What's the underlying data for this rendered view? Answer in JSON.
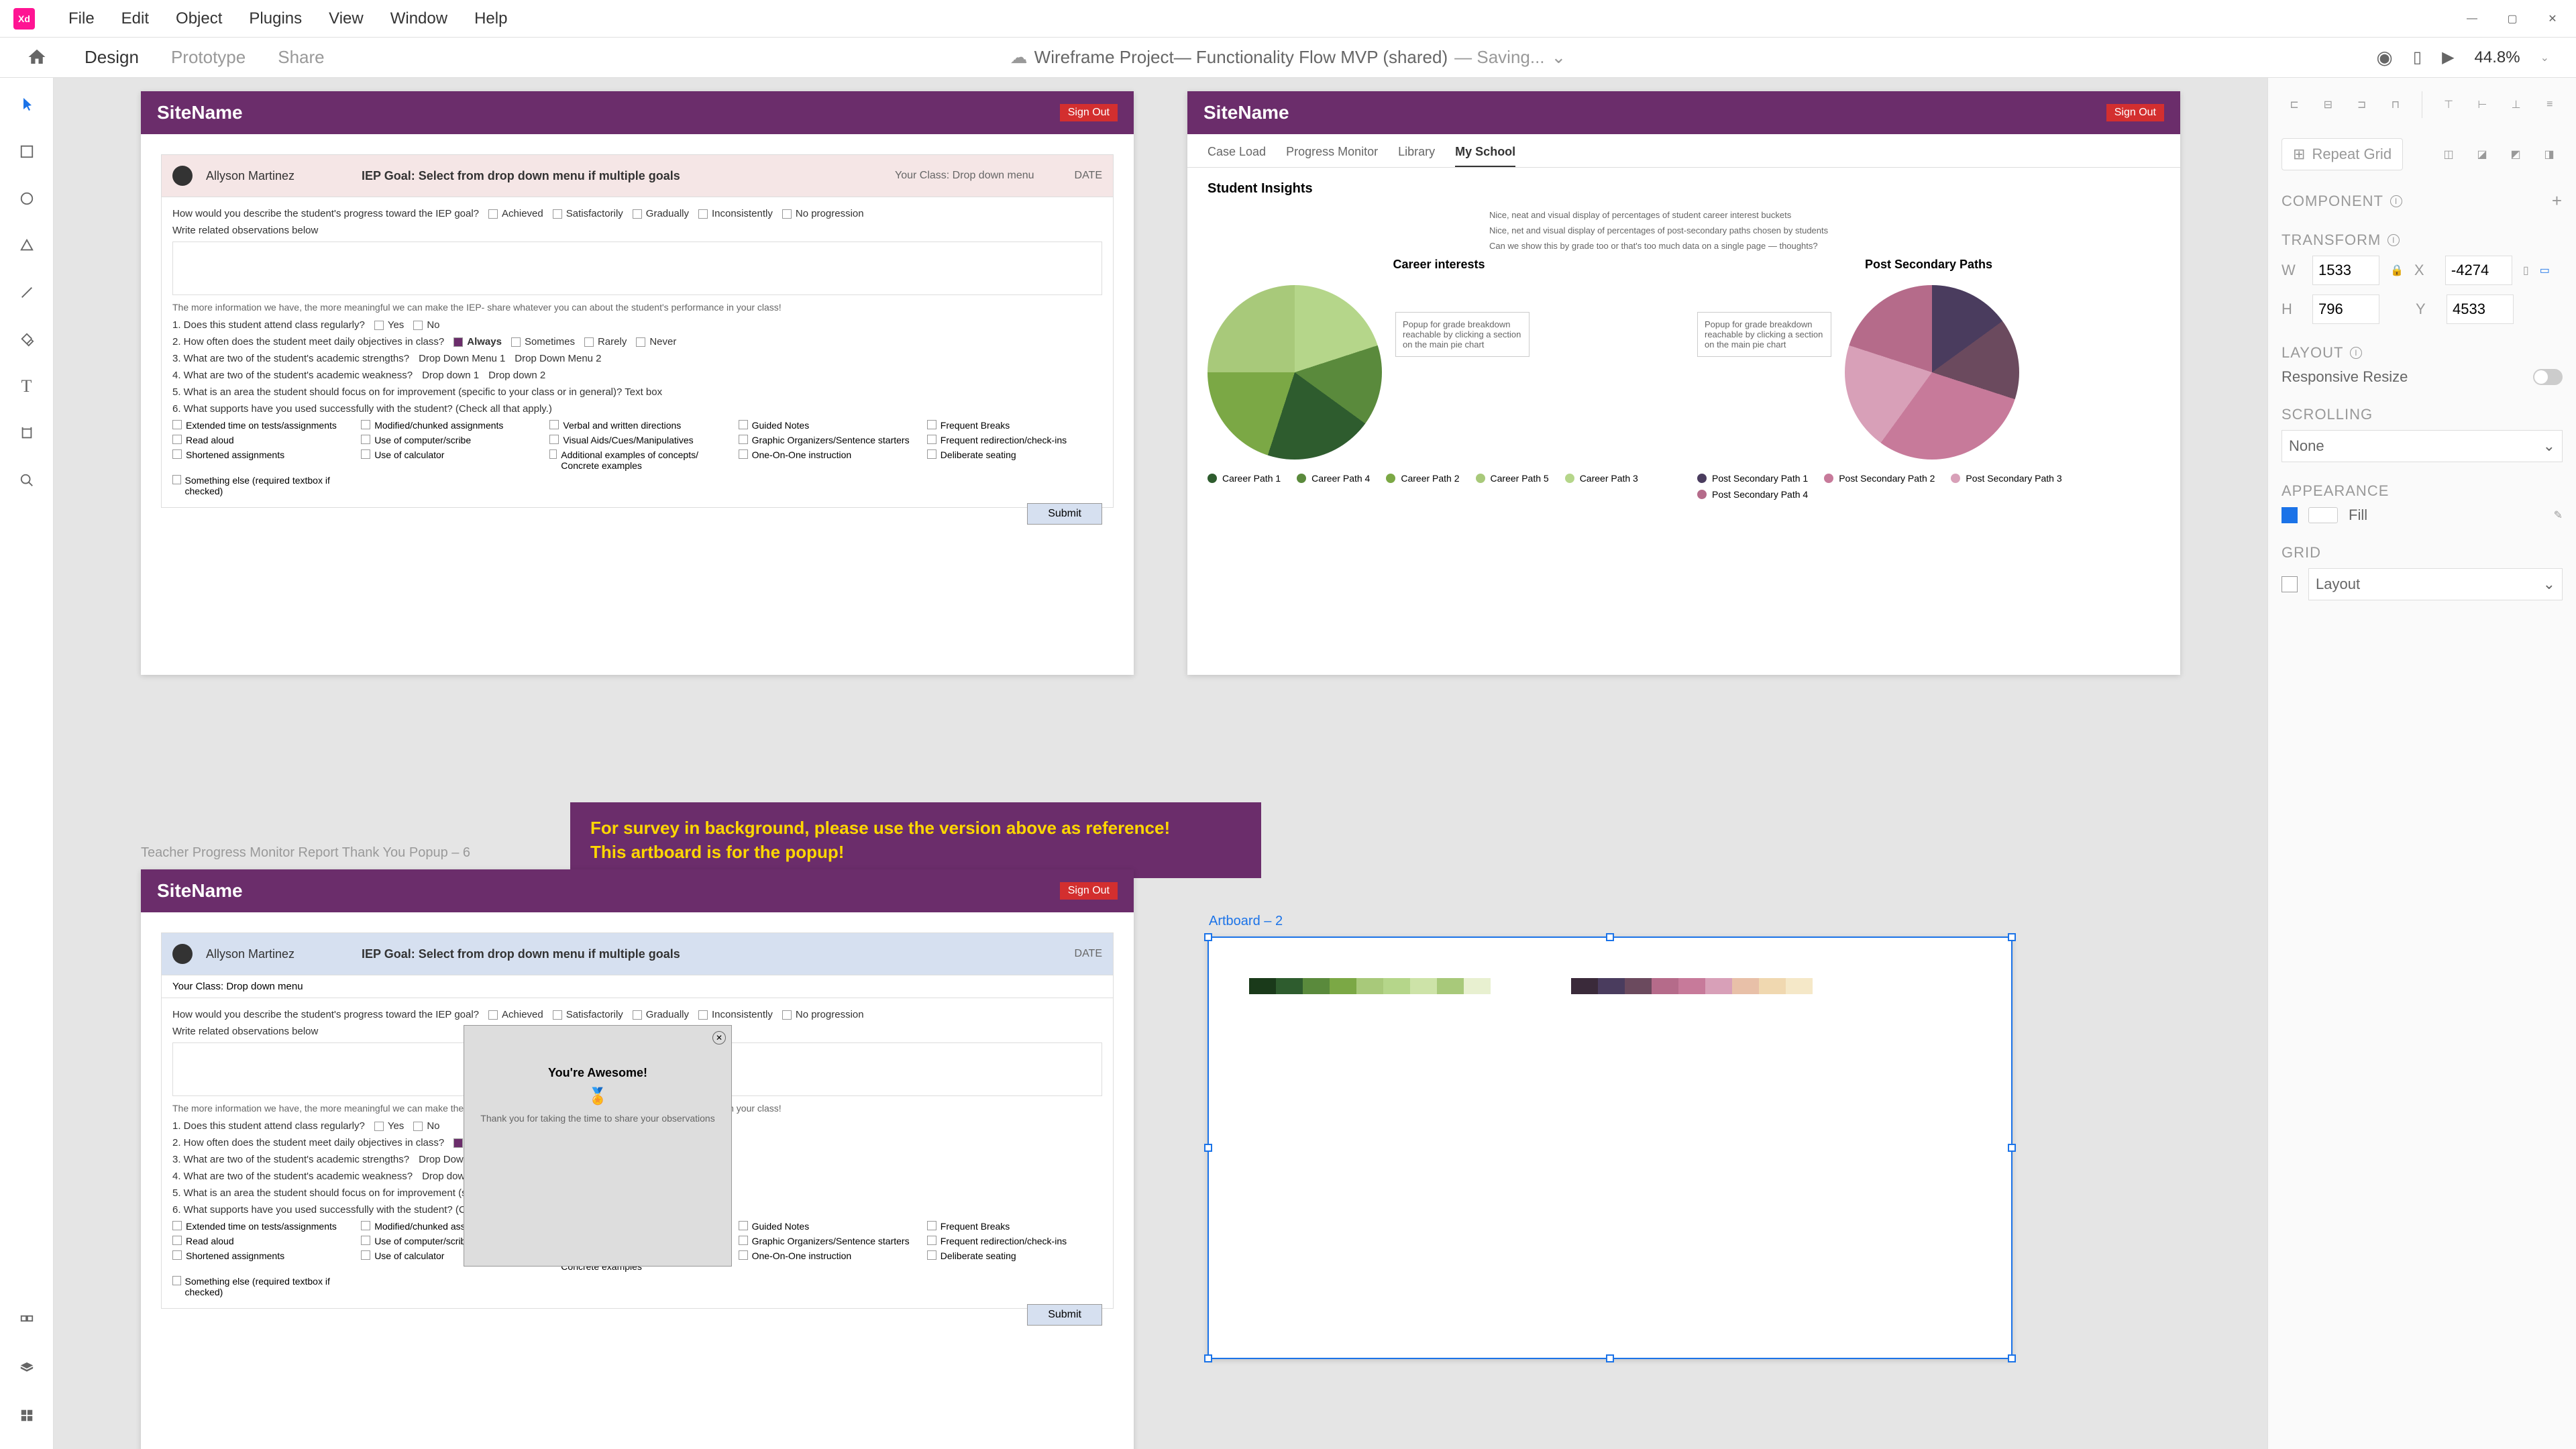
{
  "menu": {
    "items": [
      "File",
      "Edit",
      "Object",
      "Plugins",
      "View",
      "Window",
      "Help"
    ]
  },
  "tabs": {
    "design": "Design",
    "prototype": "Prototype",
    "share": "Share"
  },
  "doc": {
    "title": "Wireframe Project— Functionality Flow MVP (shared)",
    "status": "— Saving..."
  },
  "zoom": "44.8%",
  "rightPanel": {
    "repeatGrid": "Repeat Grid",
    "component": "COMPONENT",
    "transform": "TRANSFORM",
    "w": "1533",
    "x": "-4274",
    "h": "796",
    "y": "4533",
    "layout": "LAYOUT",
    "responsive": "Responsive Resize",
    "scrolling": "SCROLLING",
    "scrollValue": "None",
    "appearance": "APPEARANCE",
    "fill": "Fill",
    "grid": "GRID",
    "gridValue": "Layout"
  },
  "artboardLabels": {
    "ab3": "Teacher Progress Monitor Report Thank You Popup – 6",
    "ab4": "Artboard – 2"
  },
  "site": {
    "name": "SiteName",
    "signOut": "Sign Out"
  },
  "form": {
    "teacher": "Allyson Martinez",
    "iep": "IEP Goal:  Select from drop down menu if multiple goals",
    "yourClass": "Your Class:",
    "dropdown": "Drop down menu",
    "date": "DATE",
    "q1": "How would you describe the student's progress toward the IEP goal?",
    "q1opts": [
      "Achieved",
      "Satisfactorily",
      "Gradually",
      "Inconsistently",
      "No progression"
    ],
    "obs": "Write related observations below",
    "info": "The more information we have, the more meaningful we can make the IEP- share whatever you can about the student's performance in your class!",
    "questions": [
      "1.  Does this student attend class regularly?",
      "2.  How often does the student meet daily objectives in class?",
      "3.  What are two of the student's academic strengths?",
      "4.  What are two of the student's academic weakness?",
      "5.  What is an area the student should focus on for improvement (specific to your class or in general)? Text box",
      "6.  What supports have you used successfully with the student? (Check all that apply.)"
    ],
    "q2a": [
      "Yes",
      "No"
    ],
    "q2b": [
      "Always",
      "Sometimes",
      "Rarely",
      "Never"
    ],
    "q3opts": [
      "Drop Down Menu 1",
      "Drop Down Menu 2"
    ],
    "q4opts": [
      "Drop down 1",
      "Drop down 2"
    ],
    "supports": [
      "Extended time on tests/assignments",
      "Modified/chunked assignments",
      "Verbal and written directions",
      "Guided Notes",
      "Frequent Breaks",
      "Read aloud",
      "Use of computer/scribe",
      "Visual Aids/Cues/Manipulatives",
      "Graphic Organizers/Sentence starters",
      "Frequent redirection/check-ins",
      "Shortened assignments",
      "Use of calculator",
      "Additional examples of concepts/ Concrete examples",
      "One-On-One instruction",
      "Deliberate seating",
      "Something else   (required textbox if checked)"
    ],
    "submit": "Submit"
  },
  "insights": {
    "tabs": [
      "Case Load",
      "Progress Monitor",
      "Library",
      "My School"
    ],
    "title": "Student Insights",
    "chart1Title": "Career interests",
    "chart2Title": "Post Secondary Paths",
    "notes": [
      "Nice, neat and visual display of percentages of student career interest buckets",
      "Nice, net and visual display of percentages of post-secondary paths chosen by students",
      "Can we show this by grade too or that's too much data on a single page — thoughts?"
    ],
    "popupNote": "Popup for grade breakdown reachable by clicking a section on the main pie chart",
    "legend1": [
      "Career Path 1",
      "Career Path 4",
      "Career Path 2",
      "Career Path 5",
      "Career Path 3"
    ],
    "legend2": [
      "Post Secondary Path 1",
      "Post Secondary Path 2",
      "Post Secondary Path 3",
      "Post Secondary Path 4"
    ]
  },
  "popupBanner": {
    "line1": "For survey in background, please use the version above as reference!",
    "line2": "This artboard is for the popup!"
  },
  "popup": {
    "title": "You're Awesome!",
    "msg": "Thank you for taking the time to share your observations"
  },
  "chart_data": [
    {
      "type": "pie",
      "title": "Career interests",
      "series": [
        {
          "name": "Career Path 1",
          "value": 20,
          "color": "#2e5c2e"
        },
        {
          "name": "Career Path 2",
          "value": 20,
          "color": "#7ba845"
        },
        {
          "name": "Career Path 3",
          "value": 25,
          "color": "#a8c97a"
        },
        {
          "name": "Career Path 4",
          "value": 15,
          "color": "#5a8a3c"
        },
        {
          "name": "Career Path 5",
          "value": 20,
          "color": "#b5d68a"
        }
      ]
    },
    {
      "type": "pie",
      "title": "Post Secondary Paths",
      "series": [
        {
          "name": "Post Secondary Path 1",
          "value": 15,
          "color": "#4a3c5e"
        },
        {
          "name": "Post Secondary Path 2",
          "value": 15,
          "color": "#6b4a5e"
        },
        {
          "name": "Post Secondary Path 3",
          "value": 30,
          "color": "#c77a9a"
        },
        {
          "name": "Post Secondary Path 4",
          "value": 20,
          "color": "#d8a0b8"
        }
      ]
    }
  ]
}
